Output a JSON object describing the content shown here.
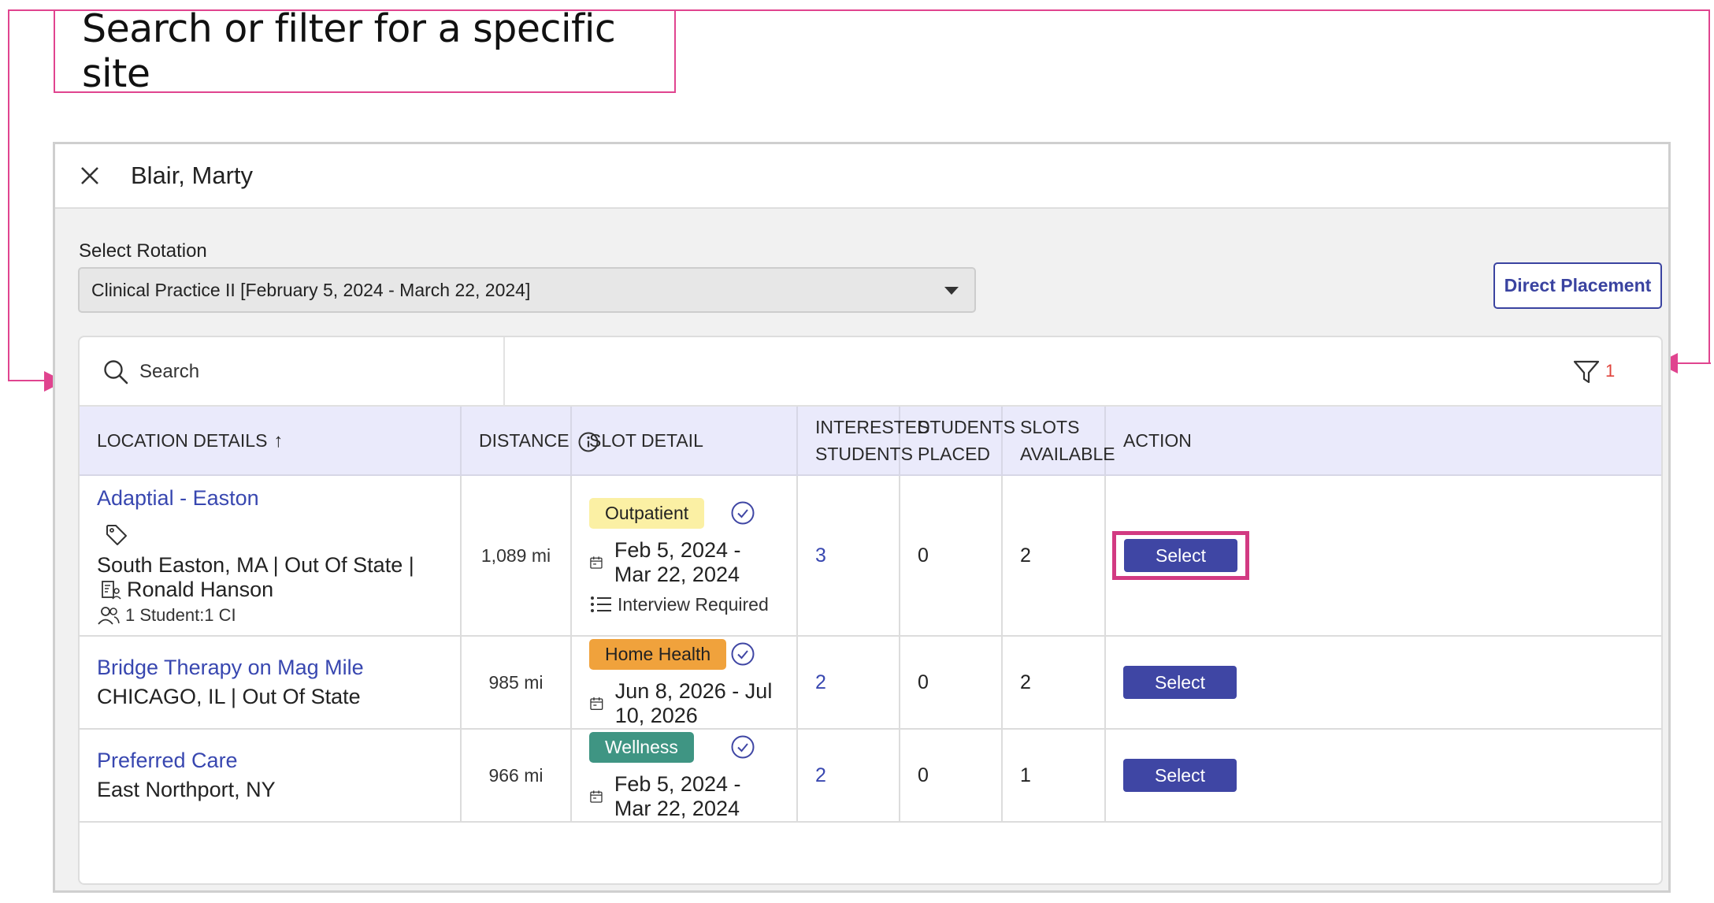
{
  "callout": {
    "text": "Search or filter for a specific site"
  },
  "header": {
    "title": "Blair, Marty",
    "close_icon": "close-icon"
  },
  "rotation": {
    "label": "Select Rotation",
    "value": "Clinical Practice II [February 5, 2024 - March 22, 2024]"
  },
  "direct_placement": {
    "label": "Direct Placement"
  },
  "search": {
    "placeholder": "Search"
  },
  "filter": {
    "count": "1"
  },
  "columns": {
    "location": "LOCATION DETAILS",
    "distance": "DISTANCE",
    "slot": "SLOT DETAIL",
    "interested": "INTERESTED STUDENTS",
    "placed": "STUDENTS PLACED",
    "available": "SLOTS AVAILABLE",
    "action": "ACTION"
  },
  "rows": [
    {
      "name": "Adaptial - Easton",
      "location": "South Easton, MA | Out Of State |",
      "ci_name": "Ronald Hanson",
      "ratio": "1 Student:1 CI",
      "distance": "1,089 mi",
      "slot_type": "Outpatient",
      "slot_color": "#fbf0a4",
      "dates": "Feb 5, 2024 - Mar 22, 2024",
      "note": "Interview Required",
      "interested": "3",
      "placed": "0",
      "available": "2",
      "action": "Select"
    },
    {
      "name": "Bridge Therapy on Mag Mile",
      "location": "CHICAGO, IL | Out Of State",
      "distance": "985 mi",
      "slot_type": "Home Health",
      "slot_color": "#f0a23c",
      "dates": "Jun 8, 2026 - Jul 10, 2026",
      "interested": "2",
      "placed": "0",
      "available": "2",
      "action": "Select"
    },
    {
      "name": "Preferred Care",
      "location": "East Northport, NY",
      "distance": "966 mi",
      "slot_type": "Wellness",
      "slot_color": "#3f9583",
      "dates": "Feb 5, 2024 - Mar 22, 2024",
      "interested": "2",
      "placed": "0",
      "available": "1",
      "action": "Select"
    }
  ],
  "colors": {
    "accent": "#3f46a4",
    "link": "#3847b0",
    "callout_border": "#e0448f",
    "highlight_border": "#d23a82",
    "header_bg": "#eaeafb"
  }
}
